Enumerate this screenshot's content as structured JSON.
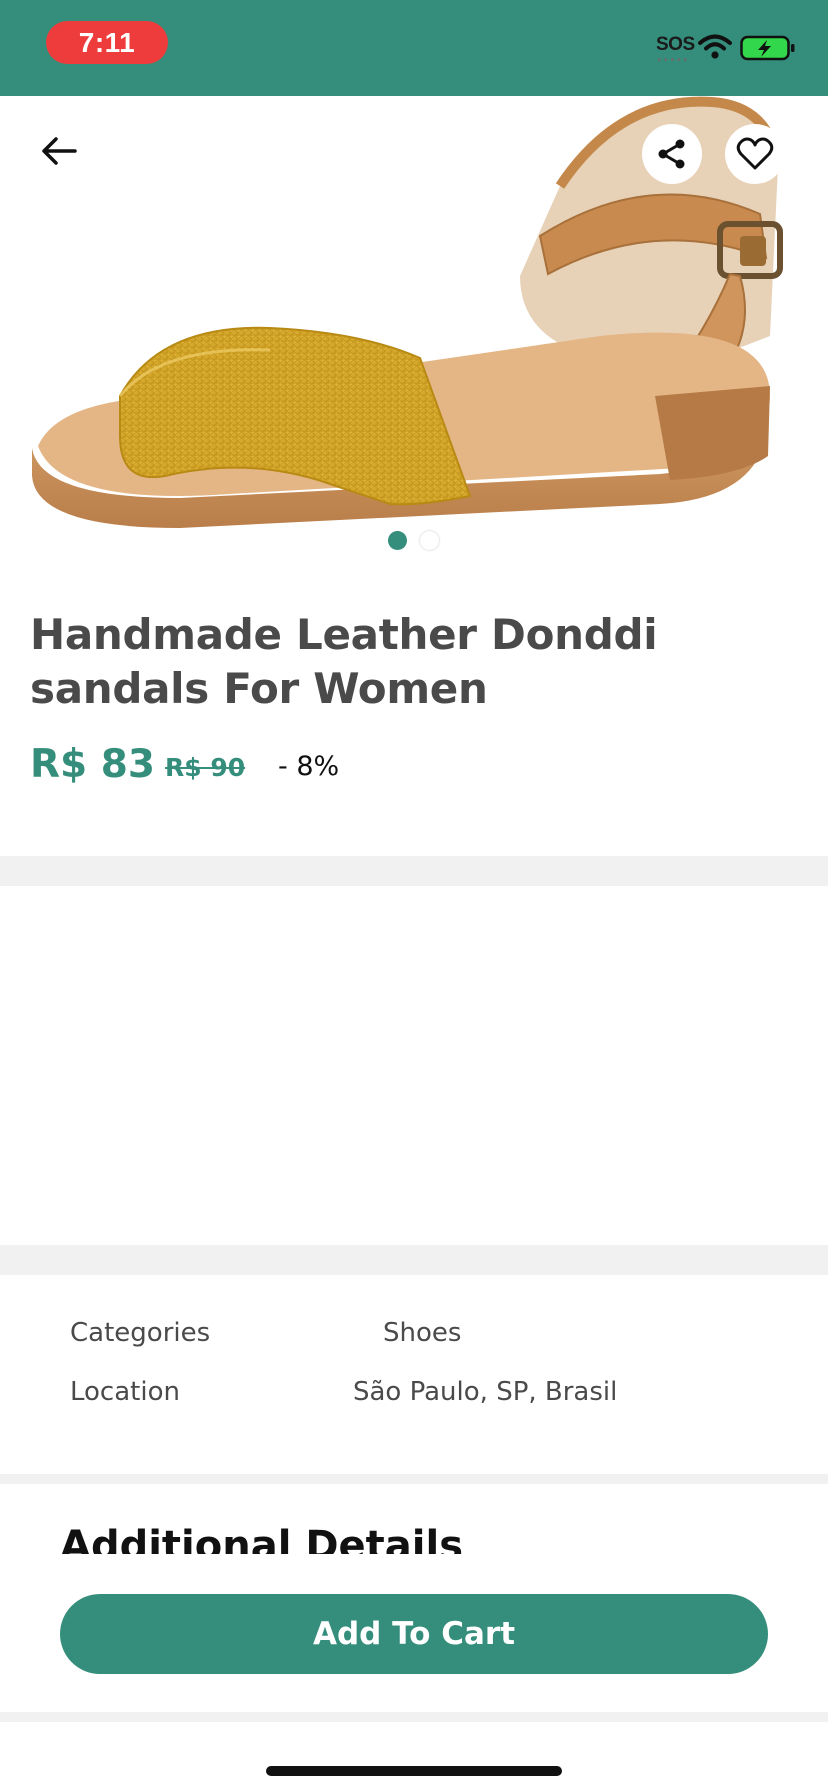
{
  "status_bar": {
    "time": "7:11",
    "sos": "SOS",
    "icons": [
      "wifi-icon",
      "battery-charging-icon"
    ],
    "background_color": "#348e7b"
  },
  "hero": {
    "image": "sandal-product-photo",
    "carousel_total": 2,
    "carousel_active": 1,
    "icons": [
      "back-arrow-icon",
      "share-icon",
      "heart-icon"
    ]
  },
  "product": {
    "title": "Handmade Leather Donddi sandals For Women",
    "price": "R$ 83",
    "old_price": "R$ 90",
    "discount": "- 8%"
  },
  "info": {
    "rows": [
      {
        "label": "Categories",
        "value": "Shoes"
      },
      {
        "label": "Location",
        "value": "São Paulo, SP, Brasil"
      }
    ]
  },
  "additional": {
    "heading": "Additional Details"
  },
  "actions": {
    "add_to_cart": "Add To Cart"
  },
  "colors": {
    "accent": "#348e7b",
    "status_time_pill": "#ee3b3b",
    "divider": "#f1f1f1",
    "text_dark": "#4a4a4a"
  }
}
